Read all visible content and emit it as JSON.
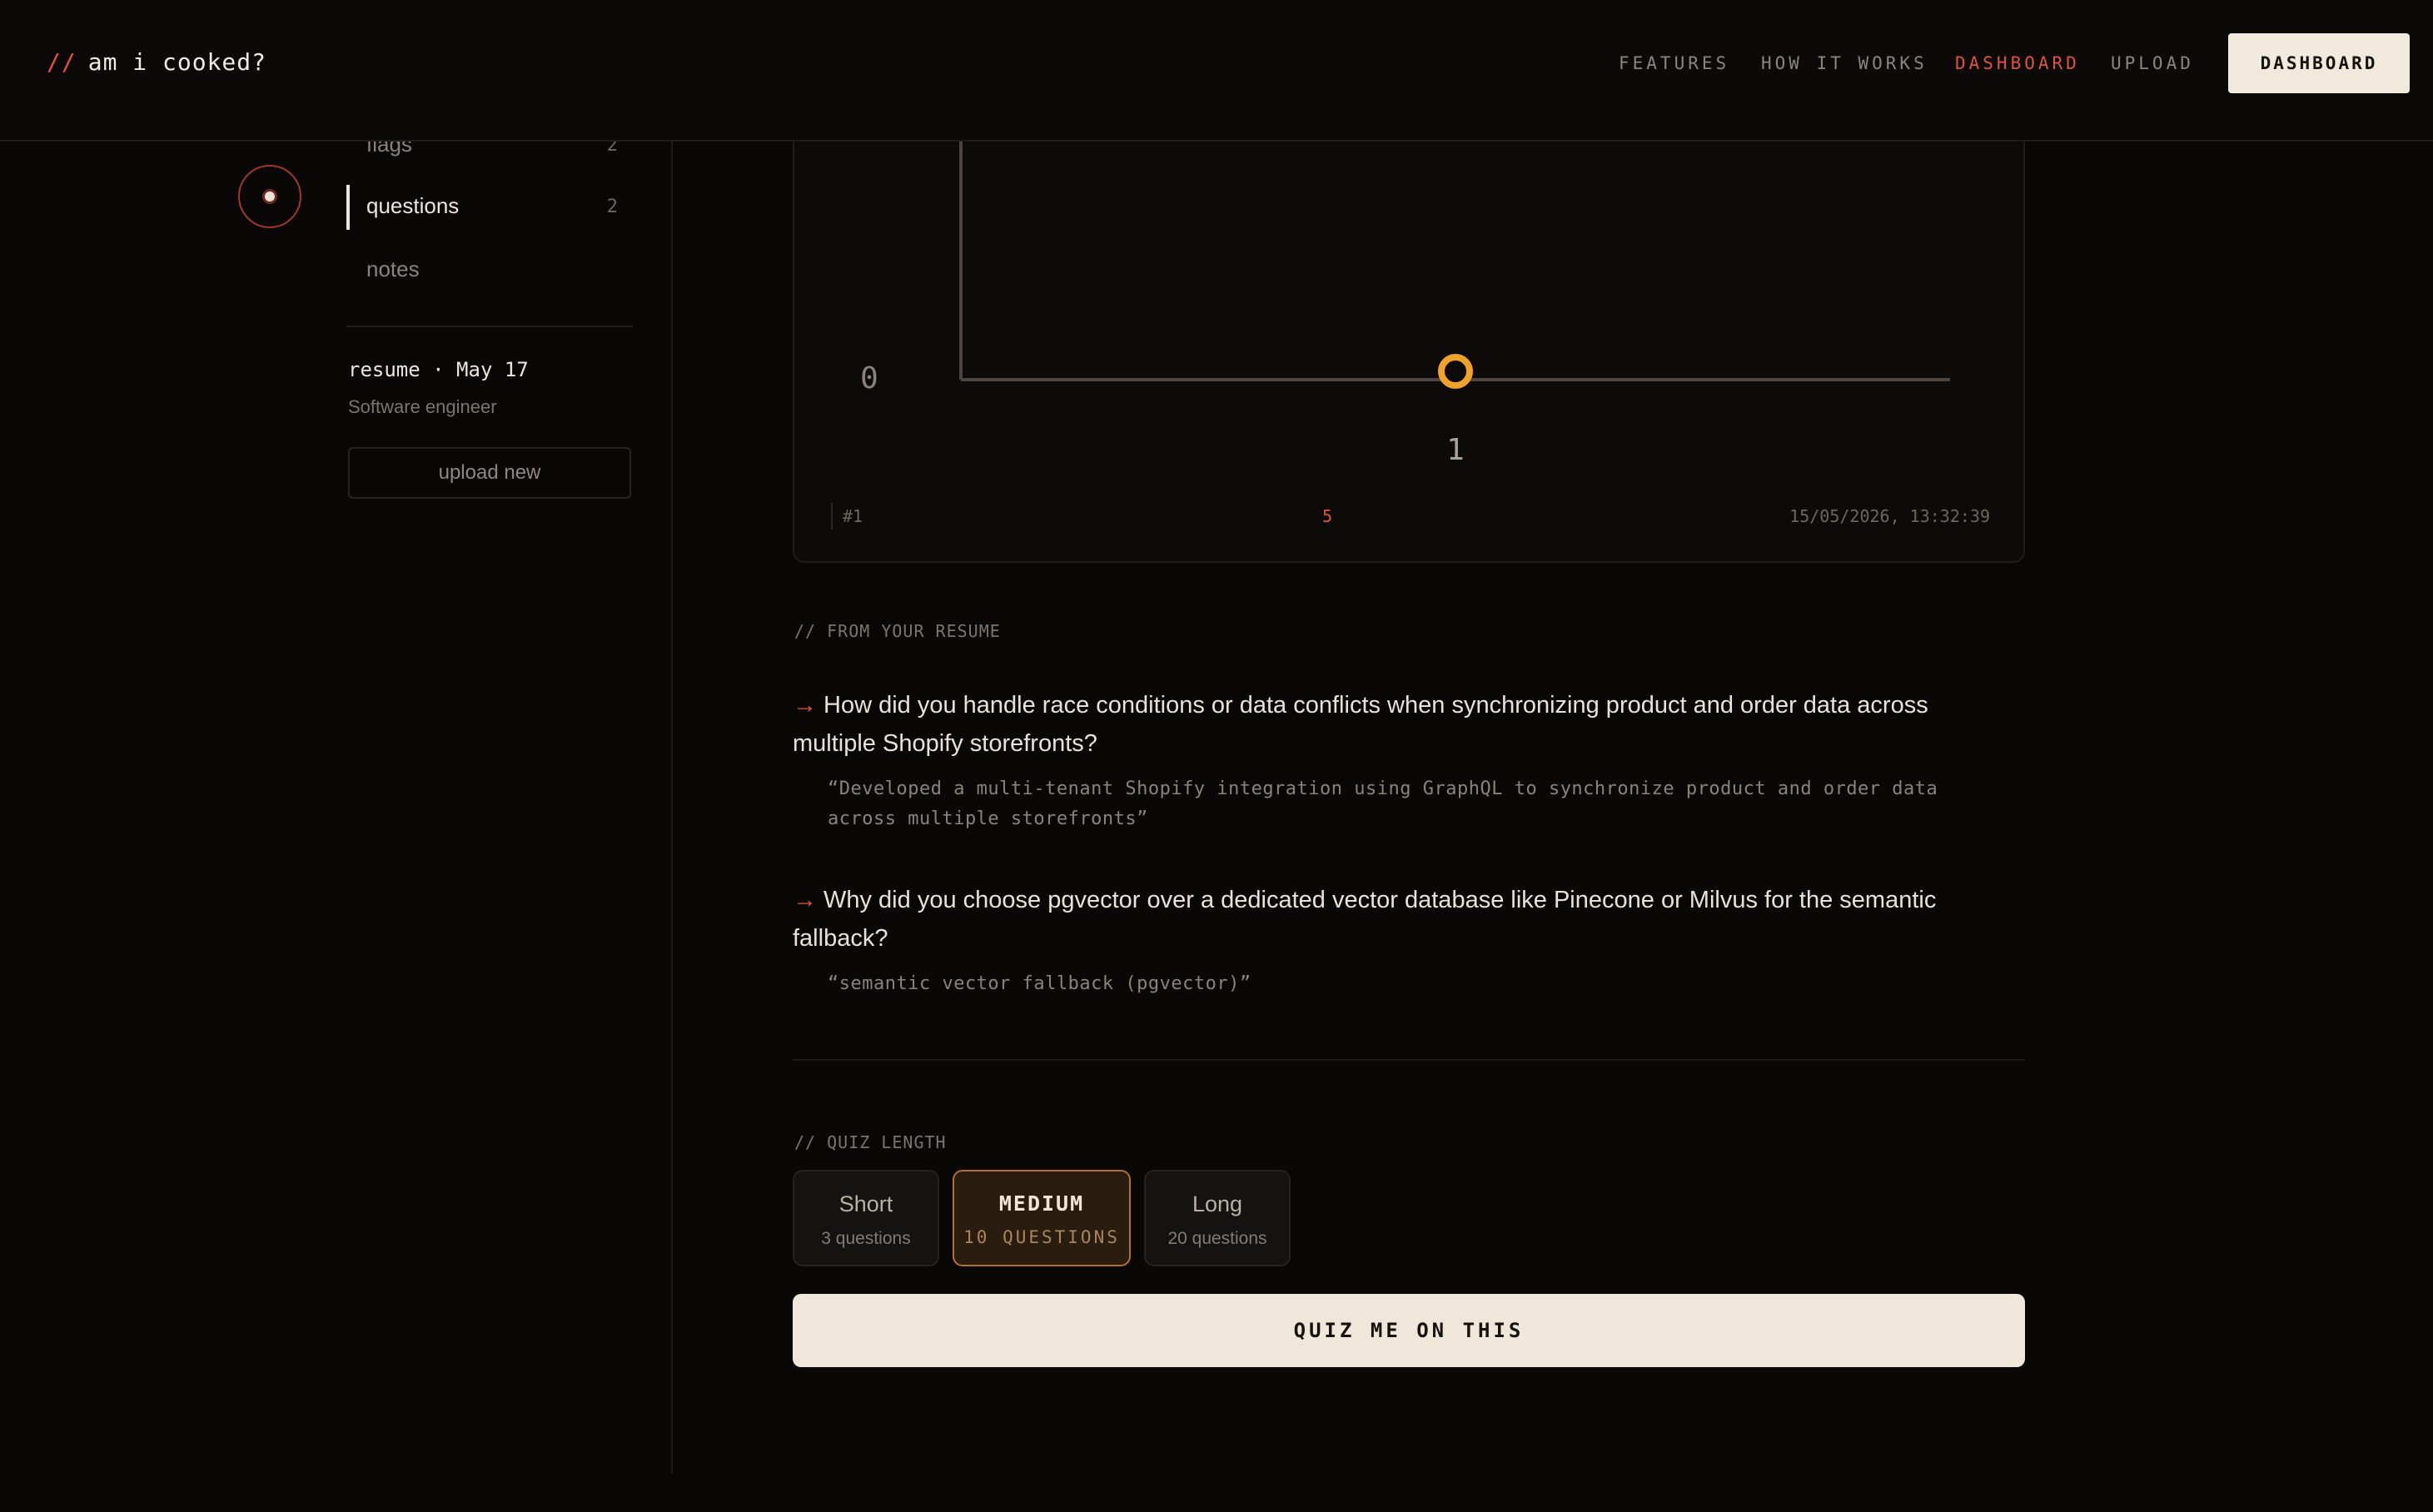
{
  "nav": {
    "brand_prefix": "//",
    "brand": "am i cooked?",
    "links": [
      "FEATURES",
      "HOW IT WORKS",
      "DASHBOARD",
      "UPLOAD"
    ],
    "active_link": "DASHBOARD",
    "cta": "DASHBOARD"
  },
  "sidebar": {
    "items": [
      {
        "label": "flags",
        "count": "2"
      },
      {
        "label": "questions",
        "count": "2"
      },
      {
        "label": "notes",
        "count": ""
      }
    ],
    "active_item": "questions",
    "resume_title": "resume · May 17",
    "resume_subtitle": "Software engineer",
    "upload_label": "upload new"
  },
  "chart_data": {
    "type": "scatter",
    "x": [
      1
    ],
    "y": [
      0
    ],
    "x_tick_labels": [
      "1"
    ],
    "y_tick_labels": [
      "0"
    ],
    "series": [
      {
        "values": [
          0
        ],
        "color": "#f0a22a"
      }
    ],
    "title": "",
    "xlabel": "",
    "ylabel": "",
    "grid": false
  },
  "chart_meta": {
    "attempt": "#1",
    "score": "5",
    "timestamp": "15/05/2026, 13:32:39"
  },
  "resume_section": {
    "label": "// FROM YOUR RESUME",
    "arrow": "→",
    "questions": [
      {
        "question": "How did you handle race conditions or data conflicts when synchronizing product and order data across multiple Shopify storefronts?",
        "quote": "“Developed a multi-tenant Shopify integration using GraphQL to synchronize product and order data across multiple storefronts”"
      },
      {
        "question": "Why did you choose pgvector over a dedicated vector database like Pinecone or Milvus for the semantic fallback?",
        "quote": "“semantic vector fallback (pgvector)”"
      }
    ]
  },
  "quiz": {
    "label": "// QUIZ LENGTH",
    "options": [
      {
        "title": "Short",
        "subtitle": "3 questions"
      },
      {
        "title": "MEDIUM",
        "subtitle": "10 QUESTIONS"
      },
      {
        "title": "Long",
        "subtitle": "20 questions"
      }
    ],
    "selected": "MEDIUM",
    "cta": "QUIZ ME ON THIS"
  },
  "colors": {
    "accent": "#e0533a",
    "point": "#f0a22a",
    "cream": "#f0e7da",
    "background": "#090807"
  }
}
